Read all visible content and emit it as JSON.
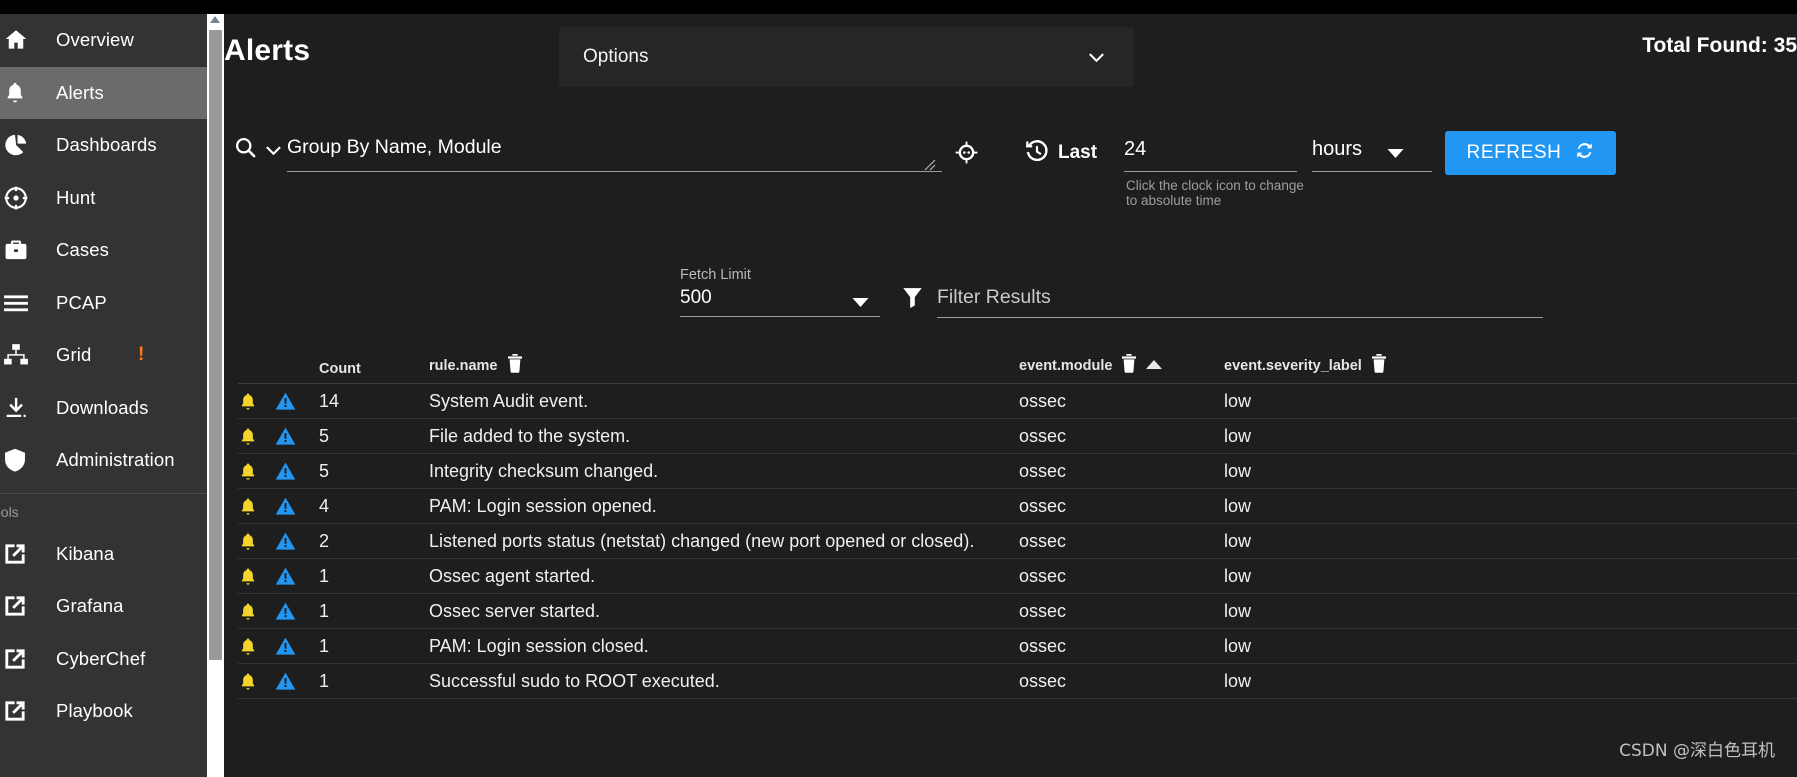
{
  "sidebar": {
    "items": [
      {
        "label": "Overview",
        "icon": "home-icon",
        "active": false
      },
      {
        "label": "Alerts",
        "icon": "bell-icon",
        "active": true
      },
      {
        "label": "Dashboards",
        "icon": "pie-chart-icon",
        "active": false
      },
      {
        "label": "Hunt",
        "icon": "crosshair-icon",
        "active": false
      },
      {
        "label": "Cases",
        "icon": "briefcase-icon",
        "active": false
      },
      {
        "label": "PCAP",
        "icon": "layers-icon",
        "active": false
      },
      {
        "label": "Grid",
        "icon": "grid-network-icon",
        "active": false,
        "badge": "!"
      },
      {
        "label": "Downloads",
        "icon": "download-icon",
        "active": false
      },
      {
        "label": "Administration",
        "icon": "shield-icon",
        "active": false
      }
    ],
    "section_label": "Tools",
    "tools": [
      {
        "label": "Kibana",
        "icon": "external-link-icon"
      },
      {
        "label": "Grafana",
        "icon": "external-link-icon"
      },
      {
        "label": "CyberChef",
        "icon": "external-link-icon"
      },
      {
        "label": "Playbook",
        "icon": "external-link-icon"
      }
    ],
    "badge_color": "#ff7a18",
    "active_bg": "#6b6b6b"
  },
  "header": {
    "title": "Alerts",
    "options_label": "Options",
    "total_found": "Total Found: 35"
  },
  "search": {
    "query": "Group By Name, Module",
    "last_label": "Last",
    "relative_value": "24",
    "relative_unit": "hours",
    "time_hint": "Click the clock icon to change to absolute time",
    "refresh_label": "REFRESH",
    "refresh_color": "#2196f3"
  },
  "filters": {
    "fetch_limit_label": "Fetch Limit",
    "fetch_limit_value": "500",
    "filter_placeholder": "Filter Results"
  },
  "table": {
    "columns": [
      {
        "label": "Count"
      },
      {
        "label": "rule.name"
      },
      {
        "label": "event.module",
        "sorted": "asc"
      },
      {
        "label": "event.severity_label"
      }
    ],
    "rows": [
      {
        "count": "14",
        "rule_name": "System Audit event.",
        "module": "ossec",
        "severity": "low"
      },
      {
        "count": "5",
        "rule_name": "File added to the system.",
        "module": "ossec",
        "severity": "low"
      },
      {
        "count": "5",
        "rule_name": "Integrity checksum changed.",
        "module": "ossec",
        "severity": "low"
      },
      {
        "count": "4",
        "rule_name": "PAM: Login session opened.",
        "module": "ossec",
        "severity": "low"
      },
      {
        "count": "2",
        "rule_name": "Listened ports status (netstat) changed (new port opened or closed).",
        "module": "ossec",
        "severity": "low"
      },
      {
        "count": "1",
        "rule_name": "Ossec agent started.",
        "module": "ossec",
        "severity": "low"
      },
      {
        "count": "1",
        "rule_name": "Ossec server started.",
        "module": "ossec",
        "severity": "low"
      },
      {
        "count": "1",
        "rule_name": "PAM: Login session closed.",
        "module": "ossec",
        "severity": "low"
      },
      {
        "count": "1",
        "rule_name": "Successful sudo to ROOT executed.",
        "module": "ossec",
        "severity": "low"
      }
    ],
    "row_icons": {
      "alert": "bell-icon",
      "escalate": "warning-triangle-icon"
    },
    "bell_color": "#f5d52b",
    "warning_color": "#2196f3"
  },
  "watermark": "CSDN @深白色耳机"
}
